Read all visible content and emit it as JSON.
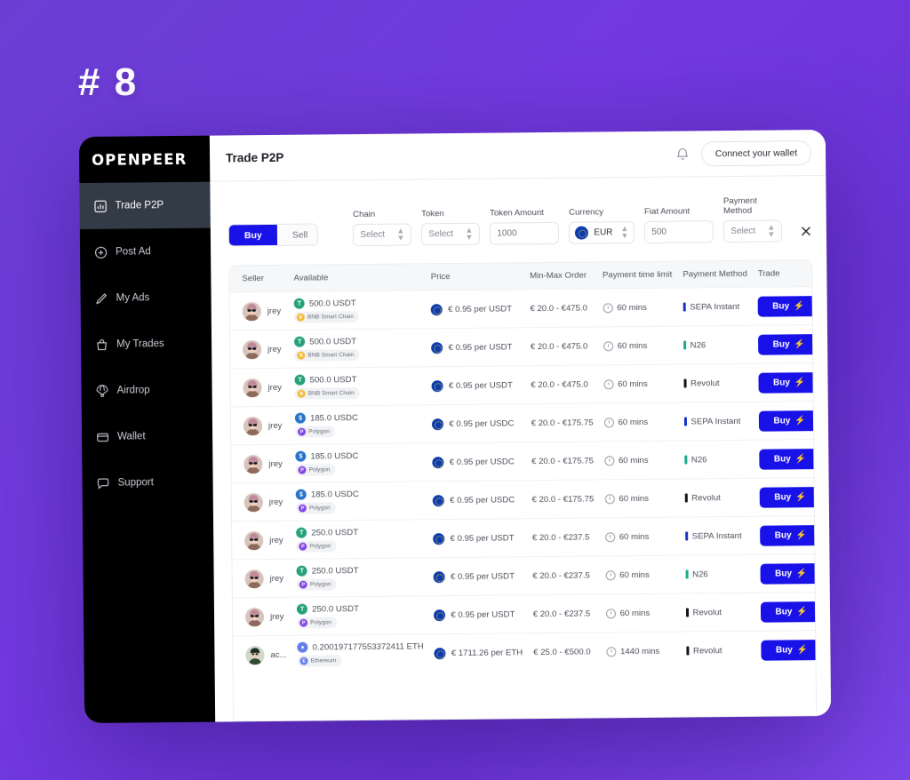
{
  "overlay": {
    "badge": "# 8"
  },
  "brand": {
    "name": "OPENPEER"
  },
  "sidebar": {
    "items": [
      {
        "label": "Trade P2P",
        "icon": "chart-bar-icon",
        "active": true
      },
      {
        "label": "Post Ad",
        "icon": "plus-circle-icon",
        "active": false
      },
      {
        "label": "My Ads",
        "icon": "pencil-icon",
        "active": false
      },
      {
        "label": "My Trades",
        "icon": "bag-icon",
        "active": false
      },
      {
        "label": "Airdrop",
        "icon": "parachute-icon",
        "active": false
      },
      {
        "label": "Wallet",
        "icon": "wallet-icon",
        "active": false
      },
      {
        "label": "Support",
        "icon": "chat-bubble-icon",
        "active": false
      }
    ]
  },
  "topbar": {
    "title": "Trade P2P",
    "bell_icon": "bell-icon",
    "wallet_button": "Connect your wallet"
  },
  "filters": {
    "toggle": {
      "buy": "Buy",
      "sell": "Sell",
      "selected": "Buy"
    },
    "chain": {
      "label": "Chain",
      "value": "Select"
    },
    "token": {
      "label": "Token",
      "value": "Select"
    },
    "token_amount": {
      "label": "Token Amount",
      "placeholder": "1000",
      "value": ""
    },
    "currency": {
      "label": "Currency",
      "value": "EUR",
      "icon": "eu-flag-icon"
    },
    "fiat_amount": {
      "label": "Fiat Amount",
      "placeholder": "500",
      "value": ""
    },
    "payment_method": {
      "label": "Payment Method",
      "value": "Select"
    },
    "clear_icon": "close-icon"
  },
  "table": {
    "headers": [
      "Seller",
      "Available",
      "Price",
      "Min-Max Order",
      "Payment time limit",
      "Payment Method",
      "Trade"
    ],
    "trade_label": "Buy",
    "rows": [
      {
        "seller": "jrey",
        "avatar": "avatar-pink",
        "amount": "500.0 USDT",
        "token": "USDT",
        "token_color": "#26a17b",
        "chain": "BNB Smart Chain",
        "chain_color": "#f3ba2f",
        "chain_glyph": "B",
        "price": "€ 0.95 per USDT",
        "minmax": "€ 20.0 - €475.0",
        "time_limit": "60 mins",
        "payment": "SEPA Instant",
        "payment_color": "#1434cb"
      },
      {
        "seller": "jrey",
        "avatar": "avatar-pink",
        "amount": "500.0 USDT",
        "token": "USDT",
        "token_color": "#26a17b",
        "chain": "BNB Smart Chain",
        "chain_color": "#f3ba2f",
        "chain_glyph": "B",
        "price": "€ 0.95 per USDT",
        "minmax": "€ 20.0 - €475.0",
        "time_limit": "60 mins",
        "payment": "N26",
        "payment_color": "#1aab8b"
      },
      {
        "seller": "jrey",
        "avatar": "avatar-pink",
        "amount": "500.0 USDT",
        "token": "USDT",
        "token_color": "#26a17b",
        "chain": "BNB Smart Chain",
        "chain_color": "#f3ba2f",
        "chain_glyph": "B",
        "price": "€ 0.95 per USDT",
        "minmax": "€ 20.0 - €475.0",
        "time_limit": "60 mins",
        "payment": "Revolut",
        "payment_color": "#14161a"
      },
      {
        "seller": "jrey",
        "avatar": "avatar-pink",
        "amount": "185.0 USDC",
        "token": "USDC",
        "token_color": "#2775ca",
        "chain": "Polygon",
        "chain_color": "#8247e5",
        "chain_glyph": "P",
        "price": "€ 0.95 per USDC",
        "minmax": "€ 20.0 - €175.75",
        "time_limit": "60 mins",
        "payment": "SEPA Instant",
        "payment_color": "#1434cb"
      },
      {
        "seller": "jrey",
        "avatar": "avatar-pink",
        "amount": "185.0 USDC",
        "token": "USDC",
        "token_color": "#2775ca",
        "chain": "Polygon",
        "chain_color": "#8247e5",
        "chain_glyph": "P",
        "price": "€ 0.95 per USDC",
        "minmax": "€ 20.0 - €175.75",
        "time_limit": "60 mins",
        "payment": "N26",
        "payment_color": "#1aab8b"
      },
      {
        "seller": "jrey",
        "avatar": "avatar-pink",
        "amount": "185.0 USDC",
        "token": "USDC",
        "token_color": "#2775ca",
        "chain": "Polygon",
        "chain_color": "#8247e5",
        "chain_glyph": "P",
        "price": "€ 0.95 per USDC",
        "minmax": "€ 20.0 - €175.75",
        "time_limit": "60 mins",
        "payment": "Revolut",
        "payment_color": "#14161a"
      },
      {
        "seller": "jrey",
        "avatar": "avatar-pink",
        "amount": "250.0 USDT",
        "token": "USDT",
        "token_color": "#26a17b",
        "chain": "Polygon",
        "chain_color": "#8247e5",
        "chain_glyph": "P",
        "price": "€ 0.95 per USDT",
        "minmax": "€ 20.0 - €237.5",
        "time_limit": "60 mins",
        "payment": "SEPA Instant",
        "payment_color": "#1434cb"
      },
      {
        "seller": "jrey",
        "avatar": "avatar-pink",
        "amount": "250.0 USDT",
        "token": "USDT",
        "token_color": "#26a17b",
        "chain": "Polygon",
        "chain_color": "#8247e5",
        "chain_glyph": "P",
        "price": "€ 0.95 per USDT",
        "minmax": "€ 20.0 - €237.5",
        "time_limit": "60 mins",
        "payment": "N26",
        "payment_color": "#1aab8b"
      },
      {
        "seller": "jrey",
        "avatar": "avatar-pink",
        "amount": "250.0 USDT",
        "token": "USDT",
        "token_color": "#26a17b",
        "chain": "Polygon",
        "chain_color": "#8247e5",
        "chain_glyph": "P",
        "price": "€ 0.95 per USDT",
        "minmax": "€ 20.0 - €237.5",
        "time_limit": "60 mins",
        "payment": "Revolut",
        "payment_color": "#14161a"
      },
      {
        "seller": "ac...",
        "avatar": "avatar-green",
        "amount": "0.200197177553372411 ETH",
        "token": "ETH",
        "token_color": "#627eea",
        "chain": "Ethereum",
        "chain_color": "#627eea",
        "chain_glyph": "E",
        "price": "€ 1711.26 per ETH",
        "minmax": "€ 25.0 - €500.0",
        "time_limit": "1440 mins",
        "payment": "Revolut",
        "payment_color": "#14161a"
      }
    ]
  }
}
